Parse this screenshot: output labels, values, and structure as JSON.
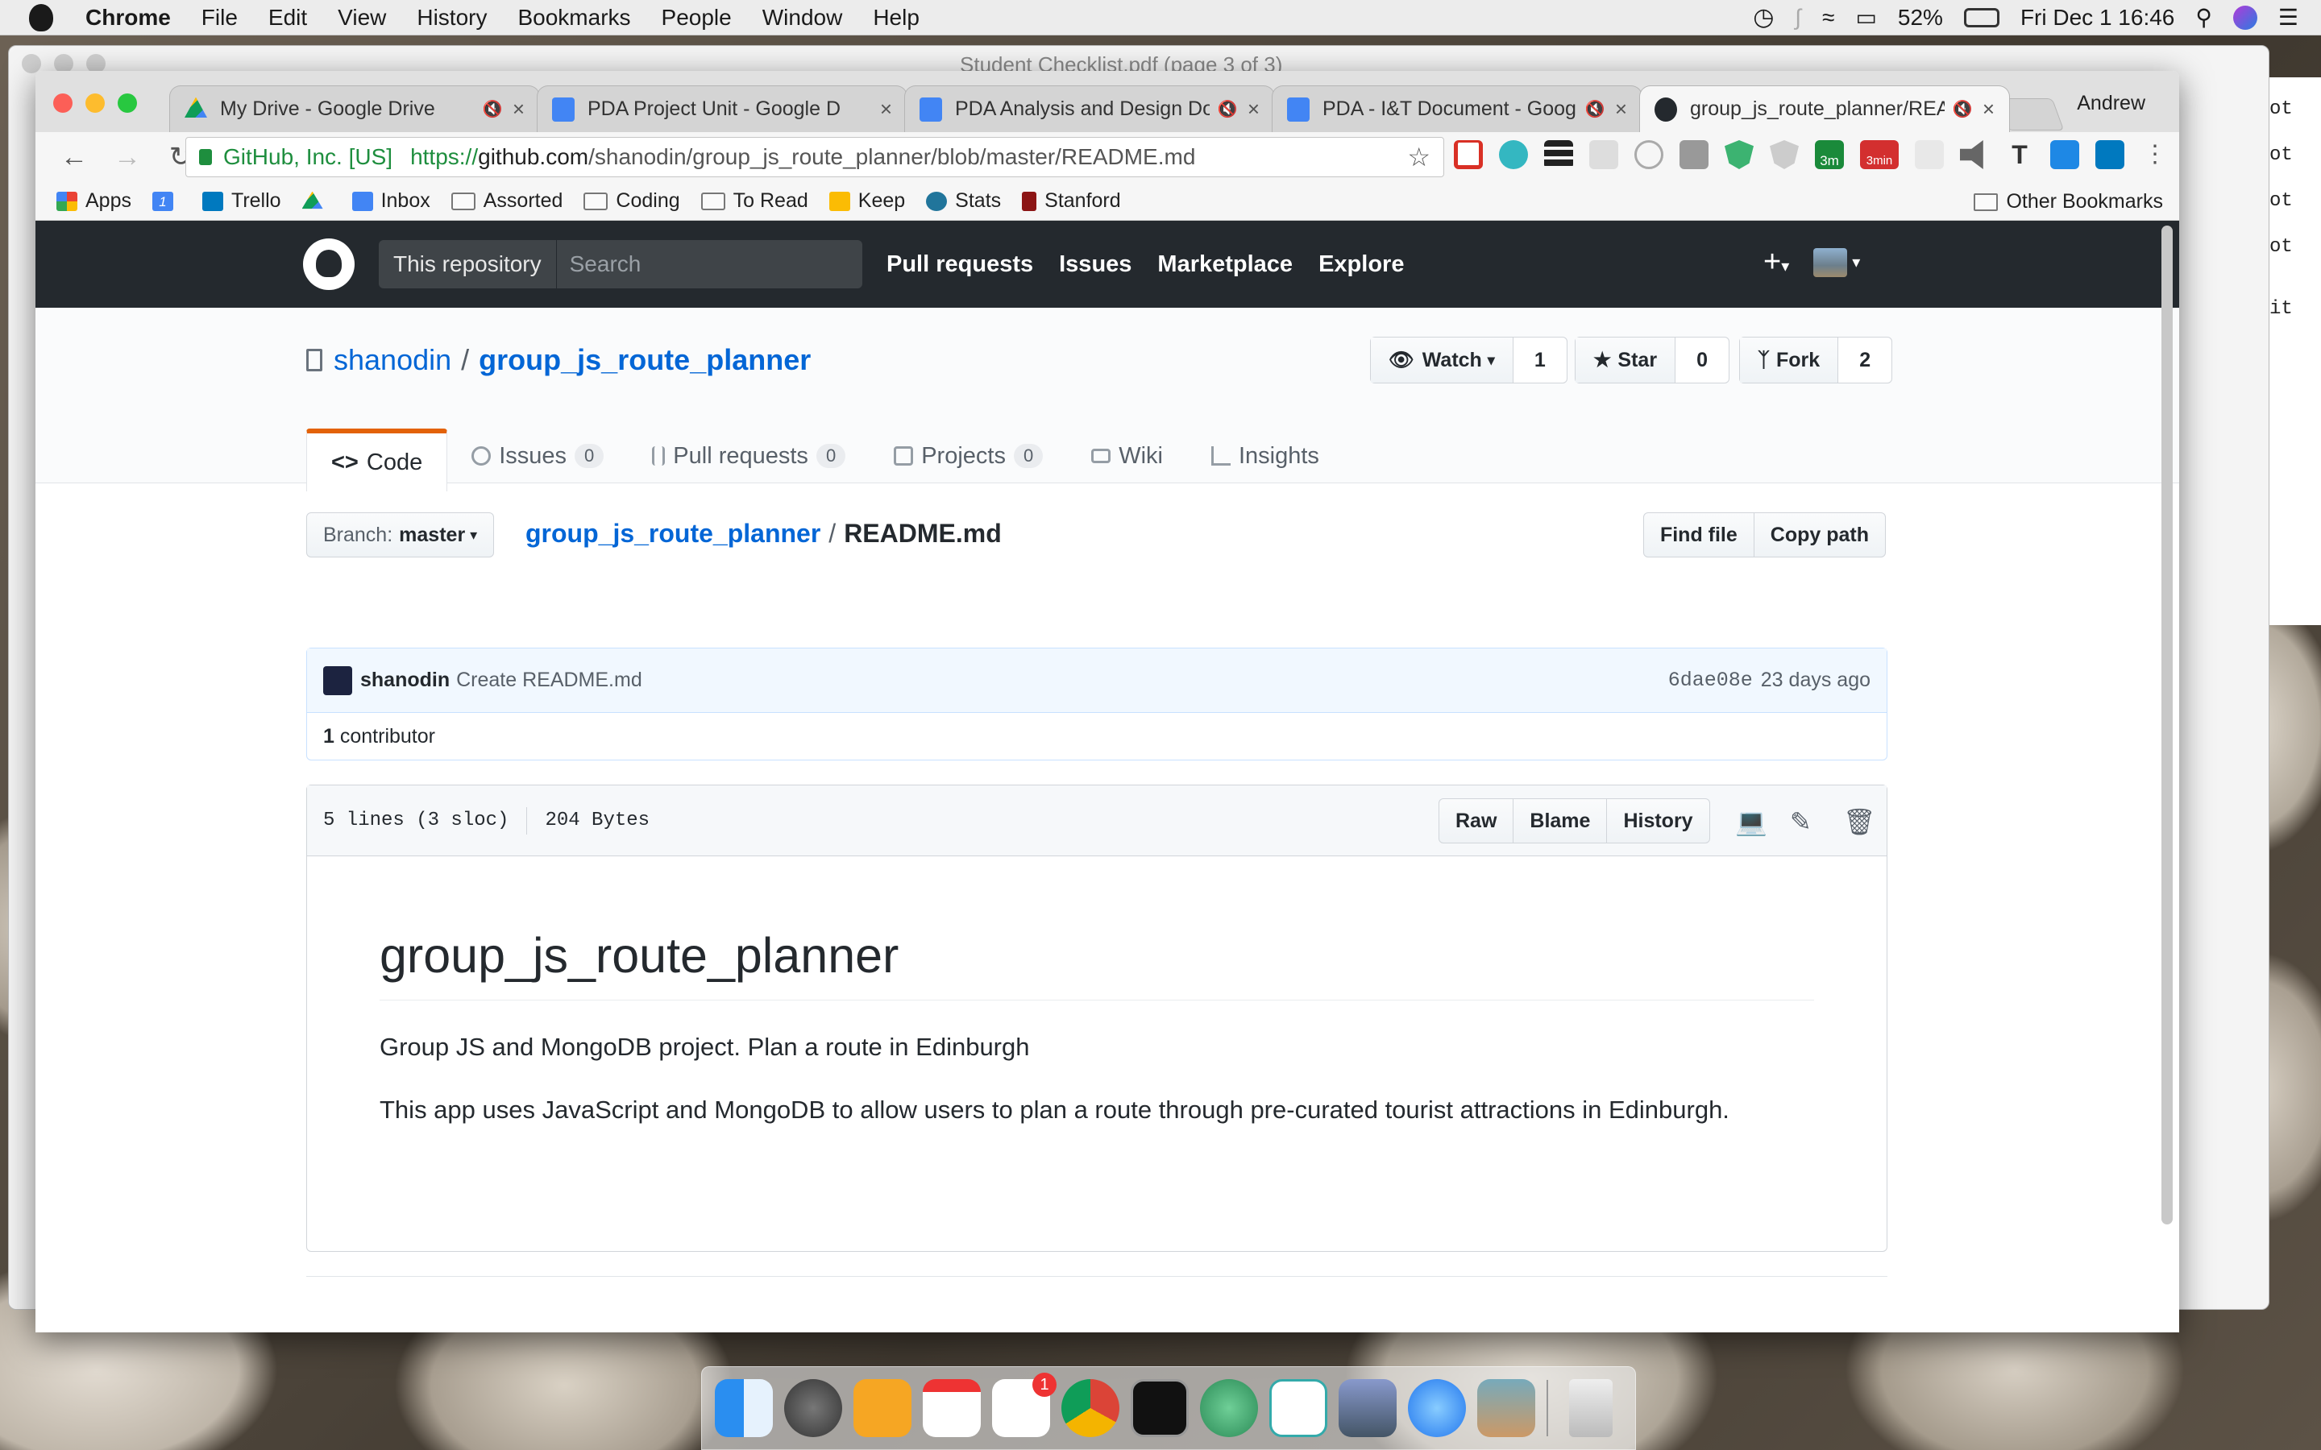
{
  "menubar": {
    "app": "Chrome",
    "items": [
      "File",
      "Edit",
      "View",
      "History",
      "Bookmarks",
      "People",
      "Window",
      "Help"
    ],
    "battery": "52%",
    "datetime": "Fri Dec 1  16:46"
  },
  "bg_window": {
    "title": "Student Checklist.pdf (page 3 of 3)",
    "side_text": [
      "ot",
      "ot",
      "ot",
      "ot",
      "it"
    ]
  },
  "browser": {
    "tabs": [
      {
        "title": "My Drive - Google Drive",
        "color": "#0f9d58"
      },
      {
        "title": "PDA Project Unit - Google D",
        "color": "#4285f4"
      },
      {
        "title": "PDA Analysis and Design Do",
        "color": "#4285f4"
      },
      {
        "title": "PDA - I&T Document - Goog",
        "color": "#4285f4"
      },
      {
        "title": "group_js_route_planner/REA",
        "color": "#24292e"
      }
    ],
    "profile": "Andrew",
    "ev": "GitHub, Inc. [US]",
    "url_scheme": "https://",
    "url_host": "github.com",
    "url_path": "/shanodin/group_js_route_planner/blob/master/README.md",
    "bookmarks": [
      "Apps",
      "Trello",
      "Inbox",
      "Assorted",
      "Coding",
      "To Read",
      "Keep",
      "Stats",
      "Stanford"
    ],
    "calendar_badge": "1",
    "other_bookmarks": "Other Bookmarks",
    "extension_badges": [
      "3m",
      "3min"
    ]
  },
  "github": {
    "scope": "This repository",
    "search_placeholder": "Search",
    "nav": [
      "Pull requests",
      "Issues",
      "Marketplace",
      "Explore"
    ],
    "owner": "shanodin",
    "repo": "group_js_route_planner",
    "watch": {
      "label": "Watch",
      "count": "1"
    },
    "star": {
      "label": "Star",
      "count": "0"
    },
    "fork": {
      "label": "Fork",
      "count": "2"
    },
    "tabs": [
      {
        "label": "Code",
        "count": ""
      },
      {
        "label": "Issues",
        "count": "0"
      },
      {
        "label": "Pull requests",
        "count": "0"
      },
      {
        "label": "Projects",
        "count": "0"
      },
      {
        "label": "Wiki",
        "count": ""
      },
      {
        "label": "Insights",
        "count": ""
      }
    ],
    "branch_label": "Branch:",
    "branch": "master",
    "crumb_repo": "group_js_route_planner",
    "crumb_file": "README.md",
    "find_file": "Find file",
    "copy_path": "Copy path",
    "commit": {
      "user": "shanodin",
      "message": "Create README.md",
      "sha": "6dae08e",
      "ago": "23 days ago"
    },
    "contributors": {
      "count": "1",
      "label": "contributor"
    },
    "file": {
      "lines": "5 lines (3 sloc)",
      "size": "204 Bytes",
      "raw": "Raw",
      "blame": "Blame",
      "history": "History"
    },
    "readme": {
      "title": "group_js_route_planner",
      "p1": "Group JS and MongoDB project. Plan a route in Edinburgh",
      "p2": "This app uses JavaScript and MongoDB to allow users to plan a route through pre-curated tourist attractions in Edinburgh."
    }
  },
  "dock": {
    "items": [
      "finder",
      "launchpad",
      "pages",
      "calendar",
      "reminders",
      "chrome",
      "terminal",
      "atom",
      "slack",
      "preview",
      "messages",
      "photos",
      "trash"
    ],
    "reminders_badge": "1"
  }
}
